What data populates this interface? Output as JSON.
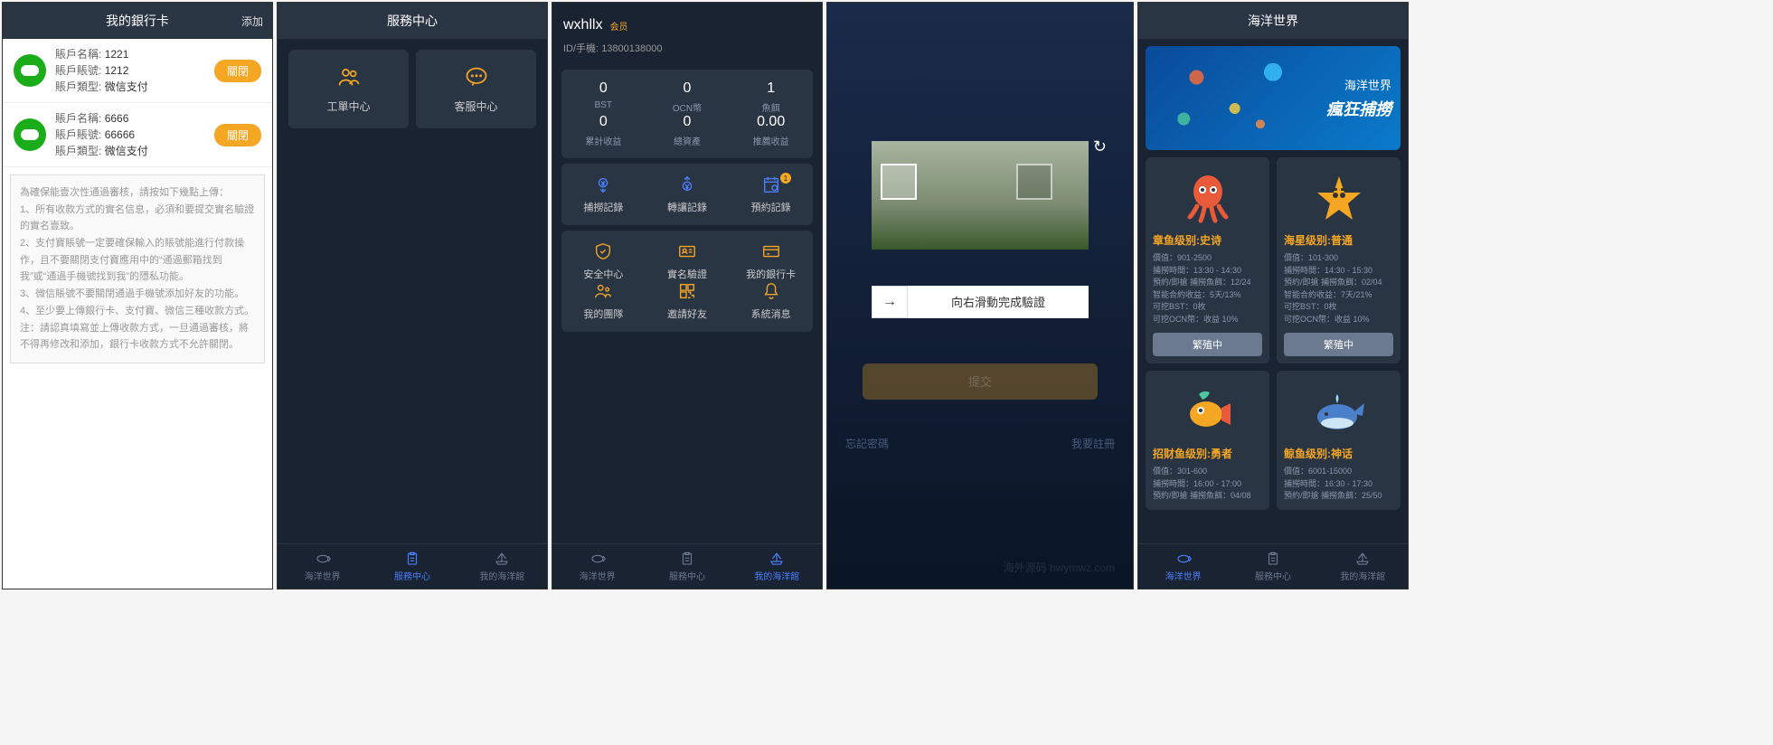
{
  "phone1": {
    "title": "我的銀行卡",
    "add": "添加",
    "cards": [
      {
        "name_label": "賬戶名稱:",
        "name": "1221",
        "acct_label": "賬戶賬號:",
        "acct": "1212",
        "type_label": "賬戶類型:",
        "type": "微信支付",
        "btn": "關閉"
      },
      {
        "name_label": "賬戶名稱:",
        "name": "6666",
        "acct_label": "賬戶賬號:",
        "acct": "66666",
        "type_label": "賬戶類型:",
        "type": "微信支付",
        "btn": "關閉"
      }
    ],
    "notice_intro": "為確保能壹次性通過審核，請按如下幾點上傳：",
    "notice_1": "1、所有收款方式的實名信息，必須和要提交實名驗證的實名壹致。",
    "notice_2": "2、支付寶賬號一定要確保輸入的賬號能進行付款操作，且不要關閉支付寶應用中的“通過郵箱找到我”或“通過手機號找到我”的隱私功能。",
    "notice_3": "3、微信賬號不要關閉通過手機號添加好友的功能。",
    "notice_4": "4、至少要上傳銀行卡、支付寶、微信三種收款方式。",
    "notice_5": "注：請認真填寫並上傳收款方式，一旦通過審核，將不得再修改和添加，銀行卡收款方式不允許關閉。"
  },
  "phone2": {
    "title": "服務中心",
    "items": [
      {
        "label": "工單中心"
      },
      {
        "label": "客服中心"
      }
    ]
  },
  "phone3": {
    "username": "wxhllx",
    "tag": "会员",
    "id_label": "ID/手機:",
    "id_value": "13800138000",
    "stats": [
      {
        "value": "0",
        "label": "BST"
      },
      {
        "value": "0",
        "label": "OCN幣"
      },
      {
        "value": "1",
        "label": "魚餌"
      },
      {
        "value": "0",
        "label": "累計收益"
      },
      {
        "value": "0",
        "label": "總資產"
      },
      {
        "value": "0.00",
        "label": "推薦收益"
      }
    ],
    "actions_top": [
      {
        "label": "捕撈記錄"
      },
      {
        "label": "轉讓記錄"
      },
      {
        "label": "預約記錄",
        "badge": "1"
      }
    ],
    "actions_mid": [
      {
        "label": "安全中心"
      },
      {
        "label": "實名驗證"
      },
      {
        "label": "我的銀行卡"
      }
    ],
    "actions_bot": [
      {
        "label": "我的團隊"
      },
      {
        "label": "邀請好友"
      },
      {
        "label": "系統消息"
      }
    ]
  },
  "phone4": {
    "slider_text": "向右滑動完成驗證",
    "submit": "提交",
    "forgot": "忘記密碼",
    "register": "我要註冊",
    "watermark": "海外源码 hwymwz.com"
  },
  "phone5": {
    "title": "海洋世界",
    "banner_text1": "海洋世界",
    "banner_text2": "瘋狂捕撈",
    "fish": [
      {
        "name": "章鱼",
        "level_label": "级别:",
        "level": "史诗",
        "stats": "價值：901-2500\n捕撈時間：13:30 - 14:30\n預約/即搶 捕撈魚餌：12/24\n智能合約收益：5天/13%\n可挖BST：0枚\n可挖OCN幣：收益 10%",
        "btn": "繁殖中"
      },
      {
        "name": "海星",
        "level_label": "级别:",
        "level": "普通",
        "stats": "價值：101-300\n捕撈時間：14:30 - 15:30\n預約/即搶 捕撈魚餌：02/04\n智能合約收益：7天/21%\n可挖BST：0枚\n可挖OCN幣：收益 10%",
        "btn": "繁殖中"
      },
      {
        "name": "招财鱼",
        "level_label": "级别:",
        "level": "勇者",
        "stats": "價值：301-600\n捕撈時間：16:00 - 17:00\n預約/即搶 捕撈魚餌：04/08",
        "btn": ""
      },
      {
        "name": "鲸鱼",
        "level_label": "级别:",
        "level": "神话",
        "stats": "價值：6001-15000\n捕撈時間：16:30 - 17:30\n預約/即搶 捕撈魚餌：25/50",
        "btn": ""
      }
    ]
  },
  "nav": {
    "ocean": "海洋世界",
    "service": "服務中心",
    "mytank": "我的海洋館"
  }
}
